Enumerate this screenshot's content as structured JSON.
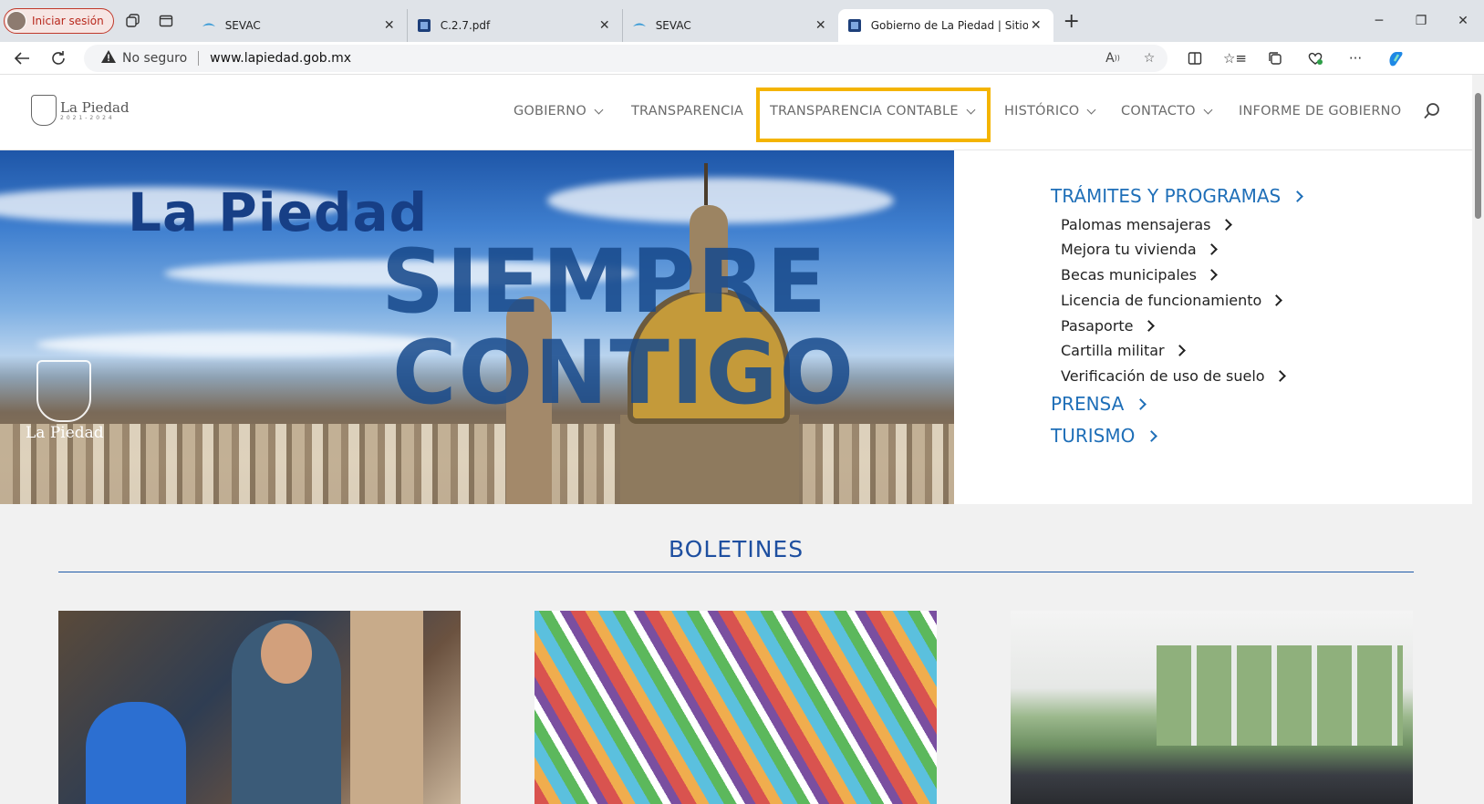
{
  "browser": {
    "profile_label": "Iniciar sesión",
    "tabs": [
      {
        "title": "SEVAC",
        "close": "✕"
      },
      {
        "title": "C.2.7.pdf",
        "close": "✕"
      },
      {
        "title": "SEVAC",
        "close": "✕"
      },
      {
        "title": "Gobierno de La Piedad | Sitio We",
        "close": "✕"
      }
    ],
    "new_tab": "+",
    "security_label": "No seguro",
    "url": "www.lapiedad.gob.mx"
  },
  "site": {
    "logo_text": "La Piedad",
    "logo_years": "2021-2024",
    "nav": [
      {
        "label": "GOBIERNO"
      },
      {
        "label": "TRANSPARENCIA"
      },
      {
        "label": "TRANSPARENCIA CONTABLE"
      },
      {
        "label": "HISTÓRICO"
      },
      {
        "label": "CONTACTO"
      },
      {
        "label": "INFORME DE GOBIERNO"
      }
    ],
    "highlight_color": "#f4b400",
    "accent_color": "#1f6fb8"
  },
  "hero": {
    "line1": "La Piedad",
    "line2": "SIEMPRE",
    "line3": "CONTIGO",
    "watermark": "La Piedad"
  },
  "side_menu": {
    "tramites": "TRÁMITES Y PROGRAMAS",
    "items": [
      "Palomas mensajeras",
      "Mejora tu vivienda",
      "Becas municipales",
      "Licencia de funcionamiento",
      "Pasaporte",
      "Cartilla militar",
      "Verificación de uso de suelo"
    ],
    "prensa": "PRENSA",
    "turismo": "TURISMO"
  },
  "boletines": {
    "title": "BOLETINES"
  }
}
